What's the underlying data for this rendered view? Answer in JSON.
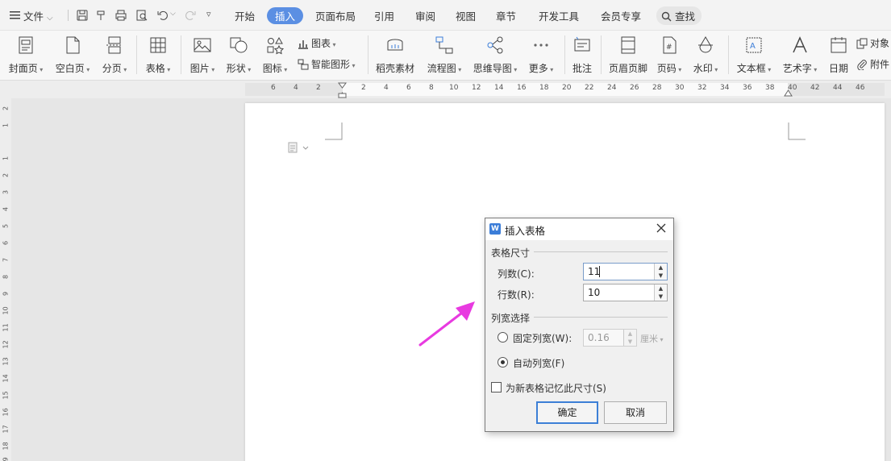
{
  "menubar": {
    "file_label": "文件",
    "tabs": [
      {
        "label": "开始"
      },
      {
        "label": "插入"
      },
      {
        "label": "页面布局"
      },
      {
        "label": "引用"
      },
      {
        "label": "审阅"
      },
      {
        "label": "视图"
      },
      {
        "label": "章节"
      },
      {
        "label": "开发工具"
      },
      {
        "label": "会员专享"
      }
    ],
    "active_tab": "插入",
    "search_label": "查找"
  },
  "ribbon": {
    "buttons": [
      {
        "label": "封面页",
        "icon": "cover-page-icon"
      },
      {
        "label": "空白页",
        "icon": "blank-page-icon"
      },
      {
        "label": "分页",
        "icon": "page-break-icon"
      },
      {
        "label": "表格",
        "icon": "table-icon"
      },
      {
        "label": "图片",
        "icon": "picture-icon"
      },
      {
        "label": "形状",
        "icon": "shape-icon"
      },
      {
        "label": "图标",
        "icon": "icons-icon"
      },
      {
        "label": "稻壳素材",
        "icon": "docer-material-icon"
      },
      {
        "label": "流程图",
        "icon": "flowchart-icon"
      },
      {
        "label": "思维导图",
        "icon": "mindmap-icon"
      },
      {
        "label": "更多",
        "icon": "more-icon"
      },
      {
        "label": "批注",
        "icon": "comment-icon"
      },
      {
        "label": "页眉页脚",
        "icon": "header-footer-icon"
      },
      {
        "label": "页码",
        "icon": "page-number-icon"
      },
      {
        "label": "水印",
        "icon": "watermark-icon"
      },
      {
        "label": "文本框",
        "icon": "textbox-icon"
      },
      {
        "label": "艺术字",
        "icon": "wordart-icon"
      },
      {
        "label": "日期",
        "icon": "date-icon"
      }
    ],
    "small_buttons": [
      {
        "label": "图表",
        "icon": "chart-icon"
      },
      {
        "label": "智能图形",
        "icon": "smart-graphic-icon"
      },
      {
        "label": "对象",
        "icon": "object-icon"
      },
      {
        "label": "附件",
        "icon": "attachment-icon"
      }
    ]
  },
  "ruler": {
    "h_ticks": [
      "6",
      "4",
      "2",
      "2",
      "4",
      "6",
      "8",
      "10",
      "12",
      "14",
      "16",
      "18",
      "20",
      "22",
      "24",
      "26",
      "28",
      "30",
      "32",
      "34",
      "36",
      "38",
      "40",
      "42",
      "44",
      "46"
    ],
    "v_ticks": [
      "2",
      "1",
      "1",
      "2",
      "3",
      "4",
      "5",
      "6",
      "7",
      "8",
      "9",
      "10",
      "11",
      "12",
      "13",
      "14",
      "15",
      "16",
      "17",
      "18",
      "19"
    ]
  },
  "dialog": {
    "title": "插入表格",
    "size_group": "表格尺寸",
    "cols_label": "列数(C):",
    "cols_value": "11",
    "rows_label": "行数(R):",
    "rows_value": "10",
    "width_group": "列宽选择",
    "fixed_label": "固定列宽(W):",
    "fixed_value": "0.16",
    "fixed_unit": "厘米",
    "auto_label": "自动列宽(F)",
    "auto_selected": true,
    "remember_label": "为新表格记忆此尺寸(S)",
    "remember_checked": false,
    "ok_label": "确定",
    "cancel_label": "取消"
  },
  "colors": {
    "accent": "#5b8fe3",
    "arrow": "#e83ae0"
  }
}
